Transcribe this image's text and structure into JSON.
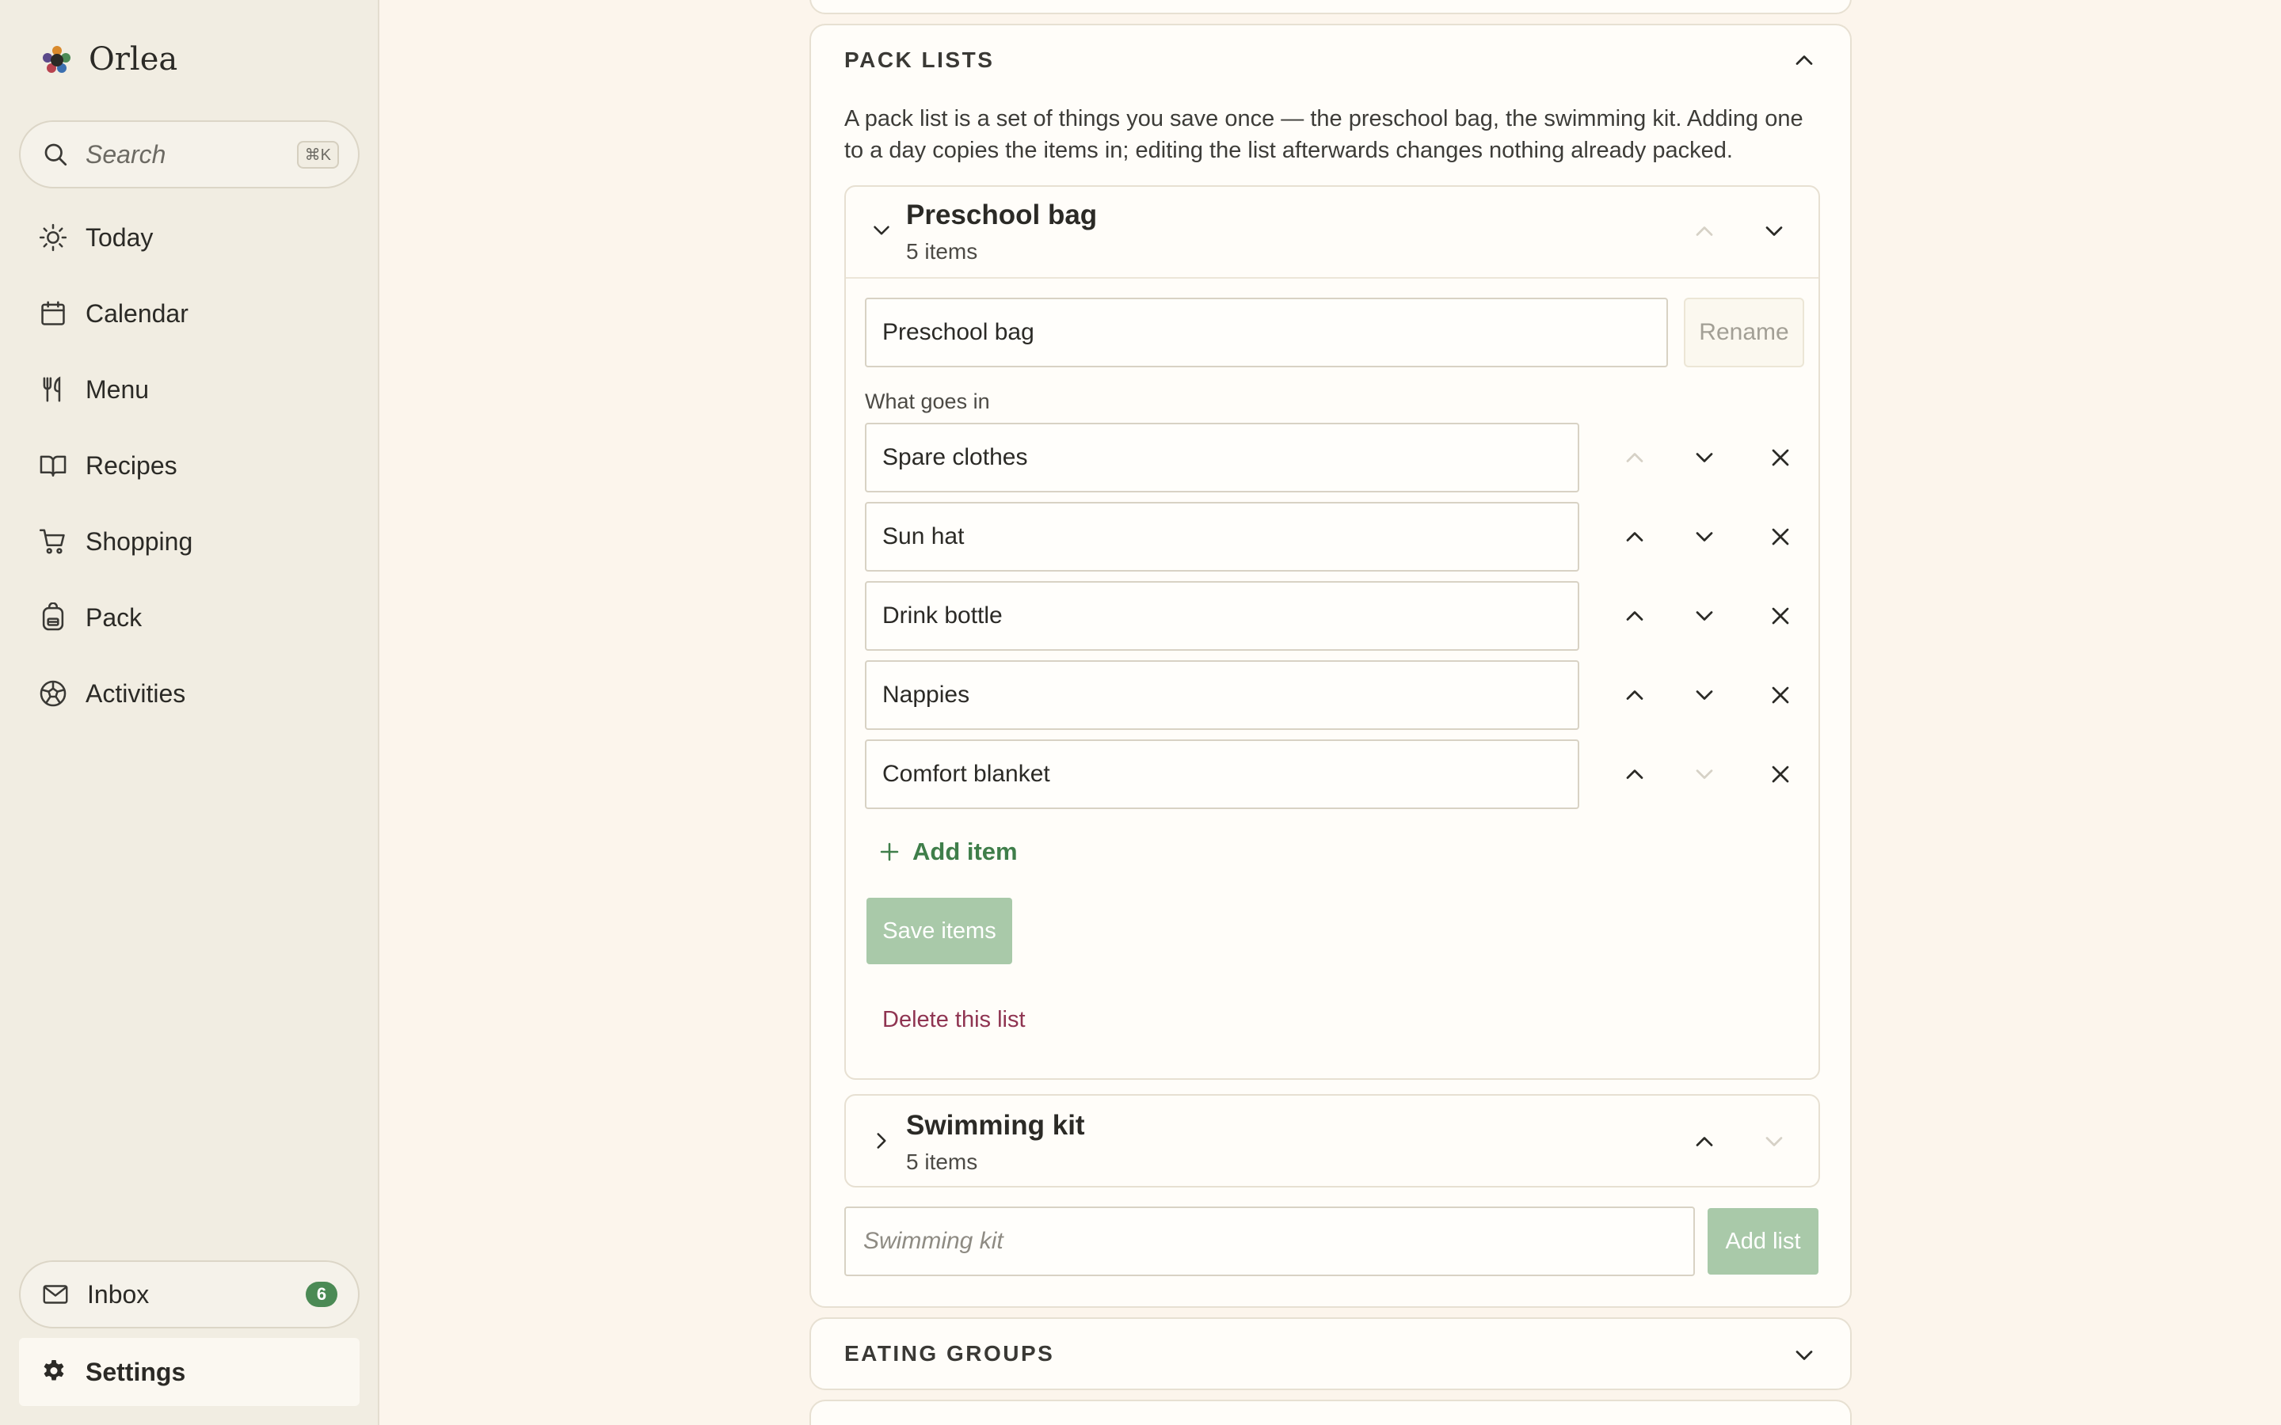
{
  "app": {
    "name": "Orlea"
  },
  "search": {
    "placeholder": "Search",
    "shortcut": "⌘K"
  },
  "nav": {
    "items": [
      {
        "label": "Today",
        "icon": "sun-icon"
      },
      {
        "label": "Calendar",
        "icon": "calendar-icon"
      },
      {
        "label": "Menu",
        "icon": "utensils-icon"
      },
      {
        "label": "Recipes",
        "icon": "book-icon"
      },
      {
        "label": "Shopping",
        "icon": "cart-icon"
      },
      {
        "label": "Pack",
        "icon": "backpack-icon"
      },
      {
        "label": "Activities",
        "icon": "ball-icon"
      }
    ],
    "inbox": {
      "label": "Inbox",
      "count": "6",
      "icon": "mail-icon"
    },
    "settings": {
      "label": "Settings",
      "icon": "gear-icon"
    }
  },
  "pack_lists": {
    "title": "PACK LISTS",
    "description": "A pack list is a set of things you save once — the preschool bag, the swimming kit. Adding one to a day copies the items in; editing the list afterwards changes nothing already packed.",
    "lists": [
      {
        "name": "Preschool bag",
        "count": "5 items",
        "expanded": true,
        "name_input": "Preschool bag",
        "rename_label": "Rename",
        "items_label": "What goes in",
        "items": [
          "Spare clothes",
          "Sun hat",
          "Drink bottle",
          "Nappies",
          "Comfort blanket"
        ],
        "add_item_label": "Add item",
        "save_label": "Save items",
        "delete_label": "Delete this list"
      },
      {
        "name": "Swimming kit",
        "count": "5 items",
        "expanded": false
      }
    ],
    "new_list": {
      "placeholder": "Swimming kit",
      "button": "Add list"
    }
  },
  "eating_groups": {
    "title": "EATING GROUPS"
  },
  "colors": {
    "background": "#fcf5ec",
    "sidebar": "#f1ede2",
    "accent_green": "#4b8a55",
    "disabled_green": "#a9c9a9",
    "danger": "#8f3451"
  }
}
